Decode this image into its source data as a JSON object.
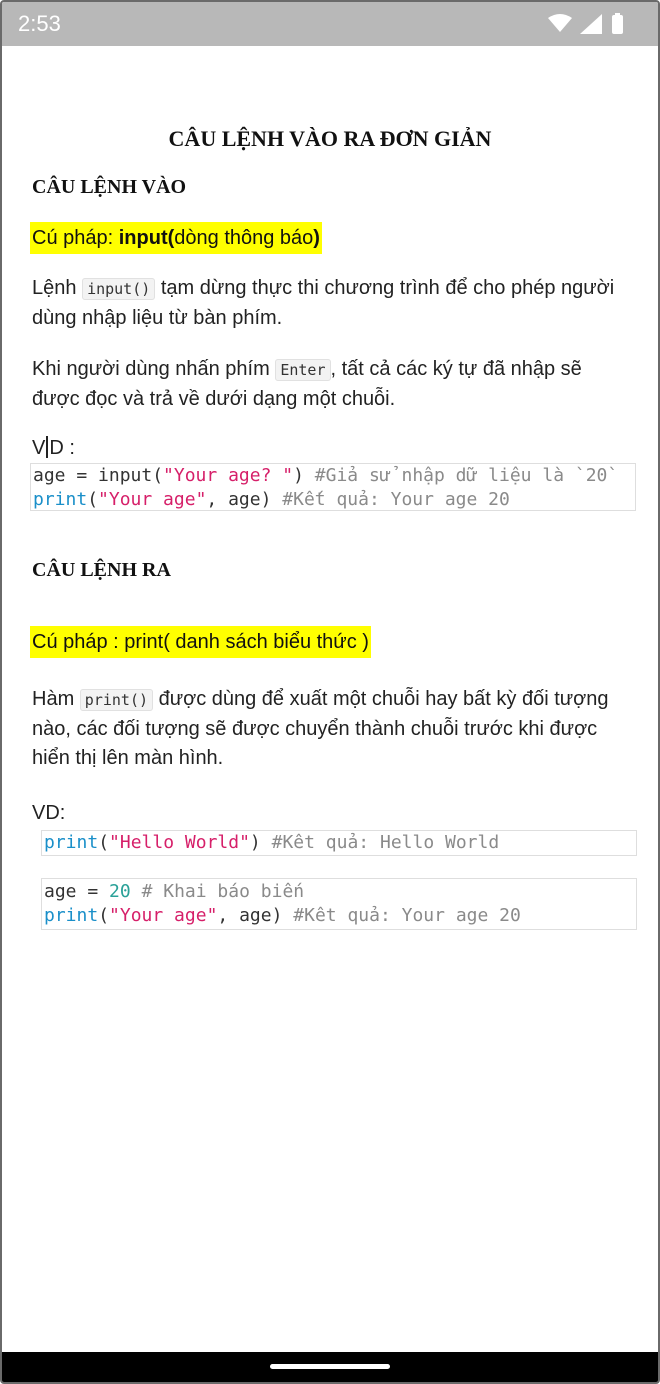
{
  "status_bar": {
    "time": "2:53"
  },
  "title": "CÂU LỆNH VÀO RA ĐƠN GIẢN",
  "input_section": {
    "heading": "CÂU LỆNH VÀO",
    "syntax_prefix": "Cú pháp: ",
    "syntax_func": "input(",
    "syntax_arg": "dòng thông báo",
    "syntax_close": ")",
    "para1_a": "Lệnh ",
    "para1_code": "input()",
    "para1_b": " tạm dừng thực thi chương trình để cho phép người dùng nhập liệu từ bàn phím.",
    "para2_a": "Khi người dùng nhấn phím ",
    "para2_code": "Enter",
    "para2_b": ", tất cả các ký tự đã nhập sẽ được đọc và trả về dưới dạng một chuỗi.",
    "example_label_a": "V",
    "example_label_b": "D :",
    "code_line1": {
      "a": "age = input(",
      "str": "\"Your age? \"",
      "b": ") ",
      "comment": "#Giả sử nhập dữ liệu là `20`"
    },
    "code_line2": {
      "kw": "print",
      "a": "(",
      "str": "\"Your age\"",
      "b": ", age) ",
      "comment": "#Kết quả: Your age 20"
    }
  },
  "output_section": {
    "heading": "CÂU LỆNH RA",
    "syntax": "Cú pháp : print( danh sách biểu thức )",
    "para_a": "Hàm ",
    "para_code": "print()",
    "para_b": " được dùng để xuất một chuỗi hay bất kỳ đối tượng nào, các đối tượng sẽ được chuyển thành chuỗi trước khi được hiển thị lên màn hình.",
    "example_label": "VD:",
    "code1": {
      "kw": "print",
      "a": "(",
      "str": "\"Hello World\"",
      "b": ") ",
      "comment": "#Kêt quả: Hello World"
    },
    "code2_line1": {
      "a": "age = ",
      "num": "20",
      "b": " ",
      "comment": "# Khai báo biến"
    },
    "code2_line2": {
      "kw": "print",
      "a": "(",
      "str": "\"Your age\"",
      "b": ", age) ",
      "comment": "#Kêt quả: Your age 20"
    }
  }
}
